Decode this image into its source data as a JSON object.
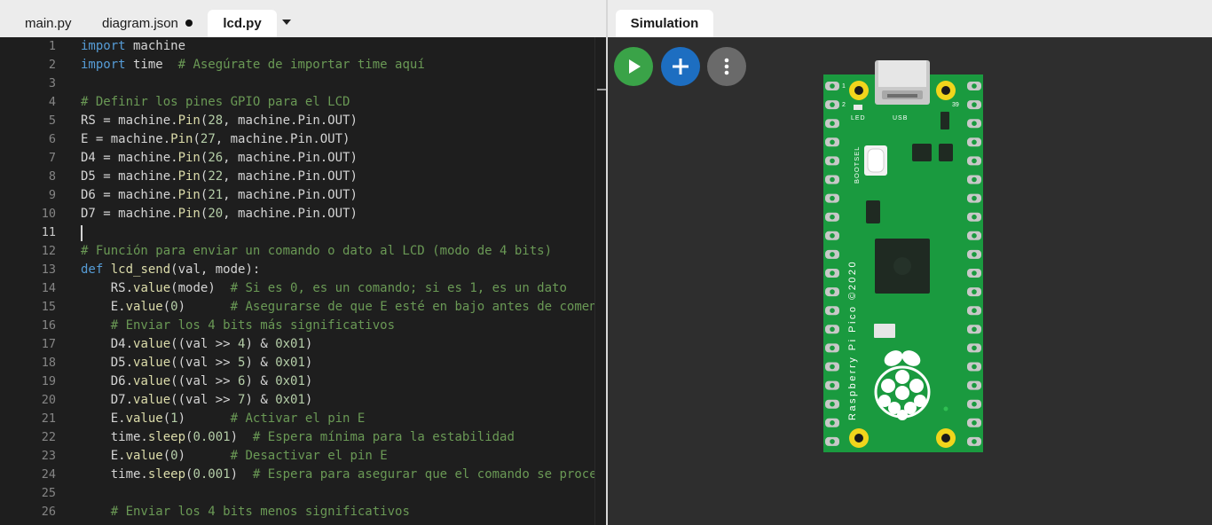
{
  "editor": {
    "tabs": [
      {
        "label": "main.py",
        "modified": false,
        "active": false
      },
      {
        "label": "diagram.json",
        "modified": true,
        "active": false
      },
      {
        "label": "lcd.py",
        "modified": false,
        "active": true
      }
    ],
    "current_line": 11,
    "lines": [
      {
        "num": "1",
        "tokens": [
          {
            "t": "import",
            "c": "k"
          },
          {
            "t": " machine",
            "c": ""
          }
        ]
      },
      {
        "num": "2",
        "tokens": [
          {
            "t": "import",
            "c": "k"
          },
          {
            "t": " time  ",
            "c": ""
          },
          {
            "t": "# Asegúrate de importar time aquí",
            "c": "c"
          }
        ]
      },
      {
        "num": "3",
        "tokens": []
      },
      {
        "num": "4",
        "tokens": [
          {
            "t": "# Definir los pines GPIO para el LCD",
            "c": "c"
          }
        ]
      },
      {
        "num": "5",
        "tokens": [
          {
            "t": "RS = machine.",
            "c": ""
          },
          {
            "t": "Pin",
            "c": "f"
          },
          {
            "t": "(",
            "c": ""
          },
          {
            "t": "28",
            "c": "n"
          },
          {
            "t": ", machine.Pin.OUT)",
            "c": ""
          }
        ]
      },
      {
        "num": "6",
        "tokens": [
          {
            "t": "E = machine.",
            "c": ""
          },
          {
            "t": "Pin",
            "c": "f"
          },
          {
            "t": "(",
            "c": ""
          },
          {
            "t": "27",
            "c": "n"
          },
          {
            "t": ", machine.Pin.OUT)",
            "c": ""
          }
        ]
      },
      {
        "num": "7",
        "tokens": [
          {
            "t": "D4 = machine.",
            "c": ""
          },
          {
            "t": "Pin",
            "c": "f"
          },
          {
            "t": "(",
            "c": ""
          },
          {
            "t": "26",
            "c": "n"
          },
          {
            "t": ", machine.Pin.OUT)",
            "c": ""
          }
        ]
      },
      {
        "num": "8",
        "tokens": [
          {
            "t": "D5 = machine.",
            "c": ""
          },
          {
            "t": "Pin",
            "c": "f"
          },
          {
            "t": "(",
            "c": ""
          },
          {
            "t": "22",
            "c": "n"
          },
          {
            "t": ", machine.Pin.OUT)",
            "c": ""
          }
        ]
      },
      {
        "num": "9",
        "tokens": [
          {
            "t": "D6 = machine.",
            "c": ""
          },
          {
            "t": "Pin",
            "c": "f"
          },
          {
            "t": "(",
            "c": ""
          },
          {
            "t": "21",
            "c": "n"
          },
          {
            "t": ", machine.Pin.OUT)",
            "c": ""
          }
        ]
      },
      {
        "num": "10",
        "tokens": [
          {
            "t": "D7 = machine.",
            "c": ""
          },
          {
            "t": "Pin",
            "c": "f"
          },
          {
            "t": "(",
            "c": ""
          },
          {
            "t": "20",
            "c": "n"
          },
          {
            "t": ", machine.Pin.OUT)",
            "c": ""
          }
        ]
      },
      {
        "num": "11",
        "tokens": []
      },
      {
        "num": "12",
        "tokens": [
          {
            "t": "# Función para enviar un comando o dato al LCD (modo de 4 bits)",
            "c": "c"
          }
        ]
      },
      {
        "num": "13",
        "tokens": [
          {
            "t": "def",
            "c": "k"
          },
          {
            "t": " ",
            "c": ""
          },
          {
            "t": "lcd_send",
            "c": "f"
          },
          {
            "t": "(val, mode):",
            "c": ""
          }
        ]
      },
      {
        "num": "14",
        "tokens": [
          {
            "t": "    RS.",
            "c": ""
          },
          {
            "t": "value",
            "c": "f"
          },
          {
            "t": "(mode)  ",
            "c": ""
          },
          {
            "t": "# Si es 0, es un comando; si es 1, es un dato",
            "c": "c"
          }
        ]
      },
      {
        "num": "15",
        "tokens": [
          {
            "t": "    E.",
            "c": ""
          },
          {
            "t": "value",
            "c": "f"
          },
          {
            "t": "(",
            "c": ""
          },
          {
            "t": "0",
            "c": "n"
          },
          {
            "t": ")      ",
            "c": ""
          },
          {
            "t": "# Asegurarse de que E esté en bajo antes de comenzar",
            "c": "c"
          }
        ]
      },
      {
        "num": "16",
        "tokens": [
          {
            "t": "    ",
            "c": ""
          },
          {
            "t": "# Enviar los 4 bits más significativos",
            "c": "c"
          }
        ]
      },
      {
        "num": "17",
        "tokens": [
          {
            "t": "    D4.",
            "c": ""
          },
          {
            "t": "value",
            "c": "f"
          },
          {
            "t": "((val >> ",
            "c": ""
          },
          {
            "t": "4",
            "c": "n"
          },
          {
            "t": ") & ",
            "c": ""
          },
          {
            "t": "0x01",
            "c": "n"
          },
          {
            "t": ")",
            "c": ""
          }
        ]
      },
      {
        "num": "18",
        "tokens": [
          {
            "t": "    D5.",
            "c": ""
          },
          {
            "t": "value",
            "c": "f"
          },
          {
            "t": "((val >> ",
            "c": ""
          },
          {
            "t": "5",
            "c": "n"
          },
          {
            "t": ") & ",
            "c": ""
          },
          {
            "t": "0x01",
            "c": "n"
          },
          {
            "t": ")",
            "c": ""
          }
        ]
      },
      {
        "num": "19",
        "tokens": [
          {
            "t": "    D6.",
            "c": ""
          },
          {
            "t": "value",
            "c": "f"
          },
          {
            "t": "((val >> ",
            "c": ""
          },
          {
            "t": "6",
            "c": "n"
          },
          {
            "t": ") & ",
            "c": ""
          },
          {
            "t": "0x01",
            "c": "n"
          },
          {
            "t": ")",
            "c": ""
          }
        ]
      },
      {
        "num": "20",
        "tokens": [
          {
            "t": "    D7.",
            "c": ""
          },
          {
            "t": "value",
            "c": "f"
          },
          {
            "t": "((val >> ",
            "c": ""
          },
          {
            "t": "7",
            "c": "n"
          },
          {
            "t": ") & ",
            "c": ""
          },
          {
            "t": "0x01",
            "c": "n"
          },
          {
            "t": ")",
            "c": ""
          }
        ]
      },
      {
        "num": "21",
        "tokens": [
          {
            "t": "    E.",
            "c": ""
          },
          {
            "t": "value",
            "c": "f"
          },
          {
            "t": "(",
            "c": ""
          },
          {
            "t": "1",
            "c": "n"
          },
          {
            "t": ")      ",
            "c": ""
          },
          {
            "t": "# Activar el pin E",
            "c": "c"
          }
        ]
      },
      {
        "num": "22",
        "tokens": [
          {
            "t": "    time.",
            "c": ""
          },
          {
            "t": "sleep",
            "c": "f"
          },
          {
            "t": "(",
            "c": ""
          },
          {
            "t": "0.001",
            "c": "n"
          },
          {
            "t": ")  ",
            "c": ""
          },
          {
            "t": "# Espera mínima para la estabilidad",
            "c": "c"
          }
        ]
      },
      {
        "num": "23",
        "tokens": [
          {
            "t": "    E.",
            "c": ""
          },
          {
            "t": "value",
            "c": "f"
          },
          {
            "t": "(",
            "c": ""
          },
          {
            "t": "0",
            "c": "n"
          },
          {
            "t": ")      ",
            "c": ""
          },
          {
            "t": "# Desactivar el pin E",
            "c": "c"
          }
        ]
      },
      {
        "num": "24",
        "tokens": [
          {
            "t": "    time.",
            "c": ""
          },
          {
            "t": "sleep",
            "c": "f"
          },
          {
            "t": "(",
            "c": ""
          },
          {
            "t": "0.001",
            "c": "n"
          },
          {
            "t": ")  ",
            "c": ""
          },
          {
            "t": "# Espera para asegurar que el comando se procese",
            "c": "c"
          }
        ]
      },
      {
        "num": "25",
        "tokens": []
      },
      {
        "num": "26",
        "tokens": [
          {
            "t": "    ",
            "c": ""
          },
          {
            "t": "# Enviar los 4 bits menos significativos",
            "c": "c"
          }
        ]
      }
    ]
  },
  "simulation": {
    "tab_label": "Simulation",
    "buttons": {
      "play": "play-icon",
      "add": "plus-icon",
      "more": "more-vertical-icon"
    },
    "board": {
      "pin_label_1": "1",
      "pin_label_2": "2",
      "pin_label_39": "39",
      "led_label": "LED",
      "usb_label": "USB",
      "bootsel_label": "BOOTSEL",
      "name_label": "Raspberry Pi Pico ©2020",
      "logo": "raspberry-logo"
    }
  },
  "colors": {
    "editor_bg": "#1e1e1e",
    "board_green": "#1a9a3f",
    "play_green": "#3aa348",
    "add_blue": "#1d6ec1",
    "more_gray": "#6a6a6a"
  }
}
